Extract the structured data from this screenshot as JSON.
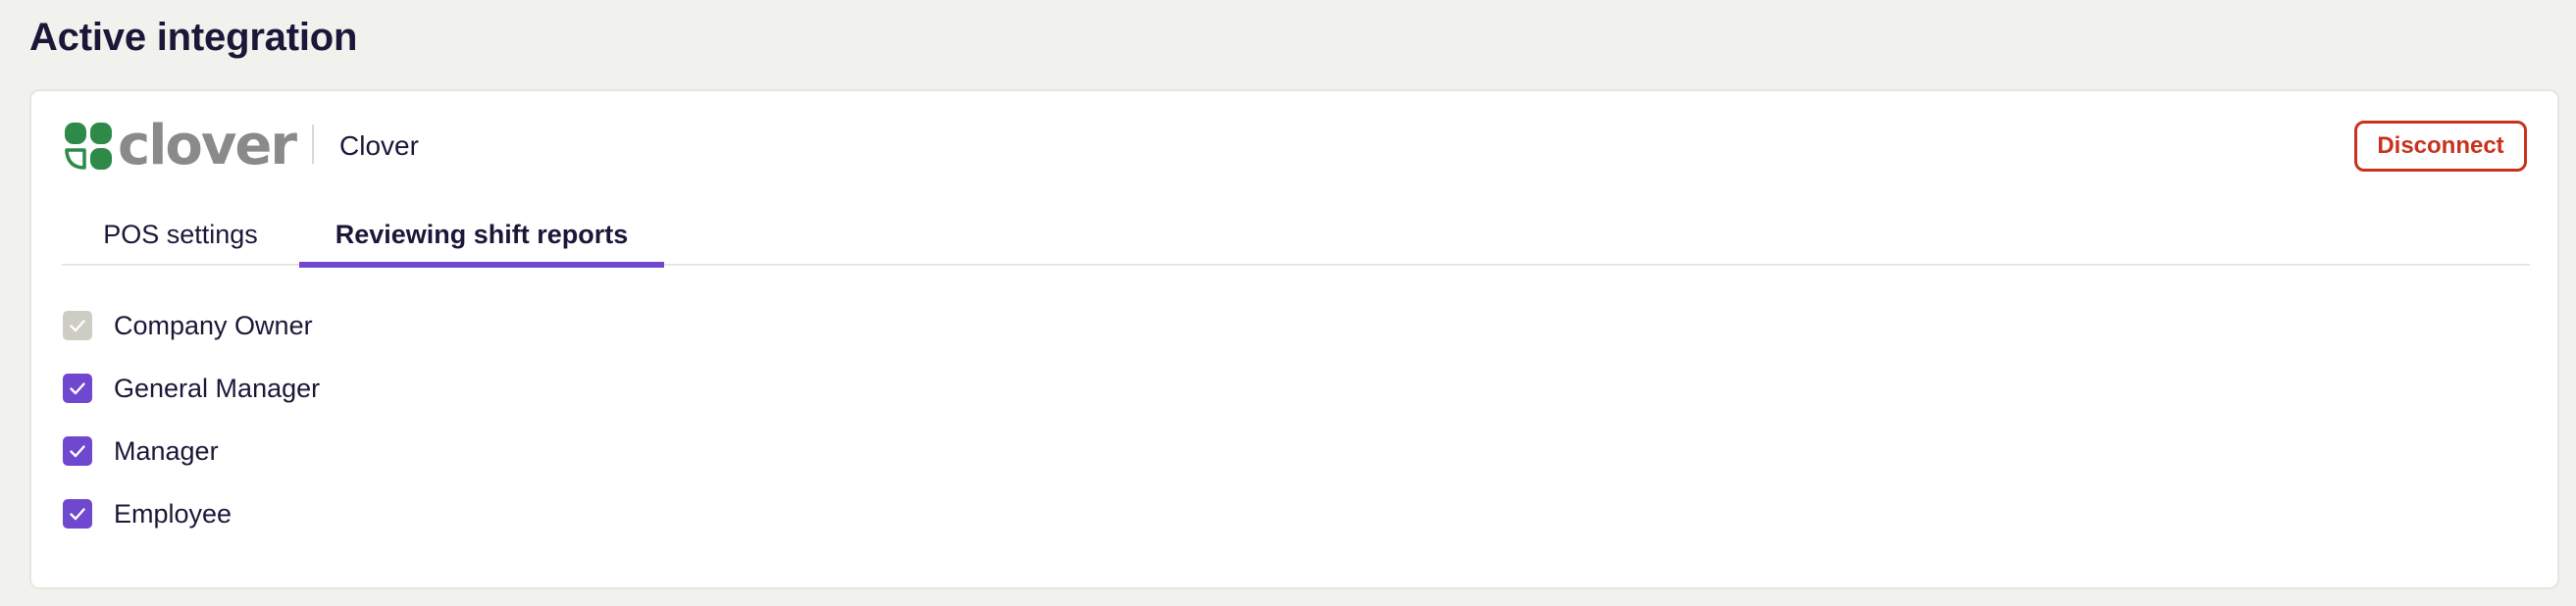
{
  "page": {
    "title": "Active integration"
  },
  "integration": {
    "logo_text": "clover",
    "provider_name": "Clover",
    "disconnect_label": "Disconnect"
  },
  "tabs": [
    {
      "label": "POS settings",
      "active": false
    },
    {
      "label": "Reviewing shift reports",
      "active": true
    }
  ],
  "roles": [
    {
      "label": "Company Owner",
      "checked": true,
      "disabled": true
    },
    {
      "label": "General Manager",
      "checked": true,
      "disabled": false
    },
    {
      "label": "Manager",
      "checked": true,
      "disabled": false
    },
    {
      "label": "Employee",
      "checked": true,
      "disabled": false
    }
  ],
  "colors": {
    "accent": "#7048d0",
    "danger": "#c8321d",
    "logo_green": "#2e8a48",
    "background": "#f1f1ed",
    "checkbox_disabled": "#cdcdc4"
  },
  "icons": {
    "logo": "clover-logo-icon",
    "checkmark": "check-icon"
  }
}
